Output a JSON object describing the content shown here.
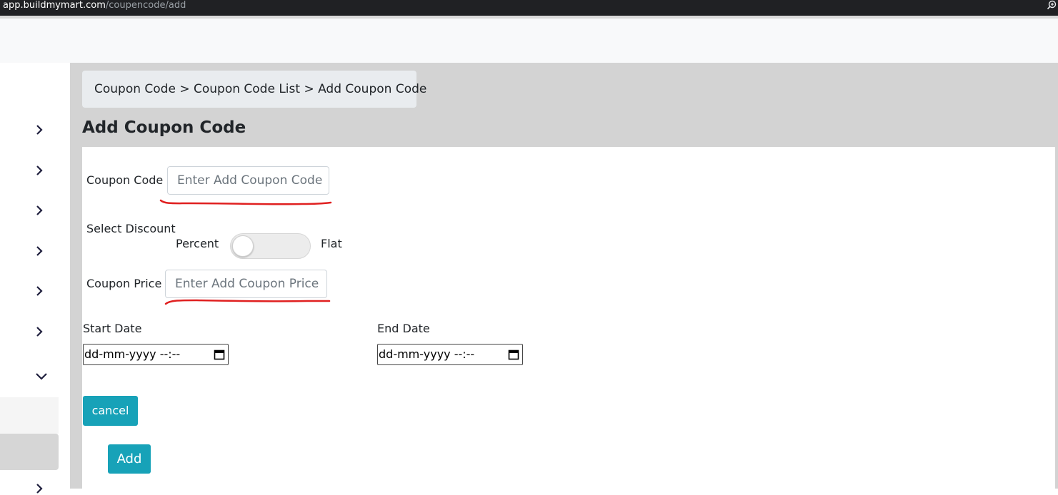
{
  "browser": {
    "url_host": "app.buildmymart.com",
    "url_path": "/coupencode/add"
  },
  "breadcrumb": "Coupon Code > Coupon Code List > Add Coupon Code",
  "page_title": "Add Coupon Code",
  "form": {
    "coupon_code_label": "Coupon Code",
    "coupon_code_placeholder": "Enter Add Coupon Code",
    "select_discount_label": "Select Discount",
    "percent_label": "Percent",
    "flat_label": "Flat",
    "coupon_price_label": "Coupon Price",
    "coupon_price_placeholder": "Enter Add Coupon Price",
    "start_date_label": "Start Date",
    "start_date_value": "dd-mm-yyyy --:--",
    "end_date_label": "End Date",
    "end_date_value": "dd-mm-yyyy --:--",
    "cancel_label": "cancel",
    "add_label": "Add"
  },
  "colors": {
    "accent": "#17a2b8",
    "annotation": "#e02020",
    "content_bg": "#d3d3d3"
  },
  "icons": [
    "chevron-right-icon",
    "chevron-down-icon",
    "calendar-icon",
    "zoom-icon"
  ]
}
